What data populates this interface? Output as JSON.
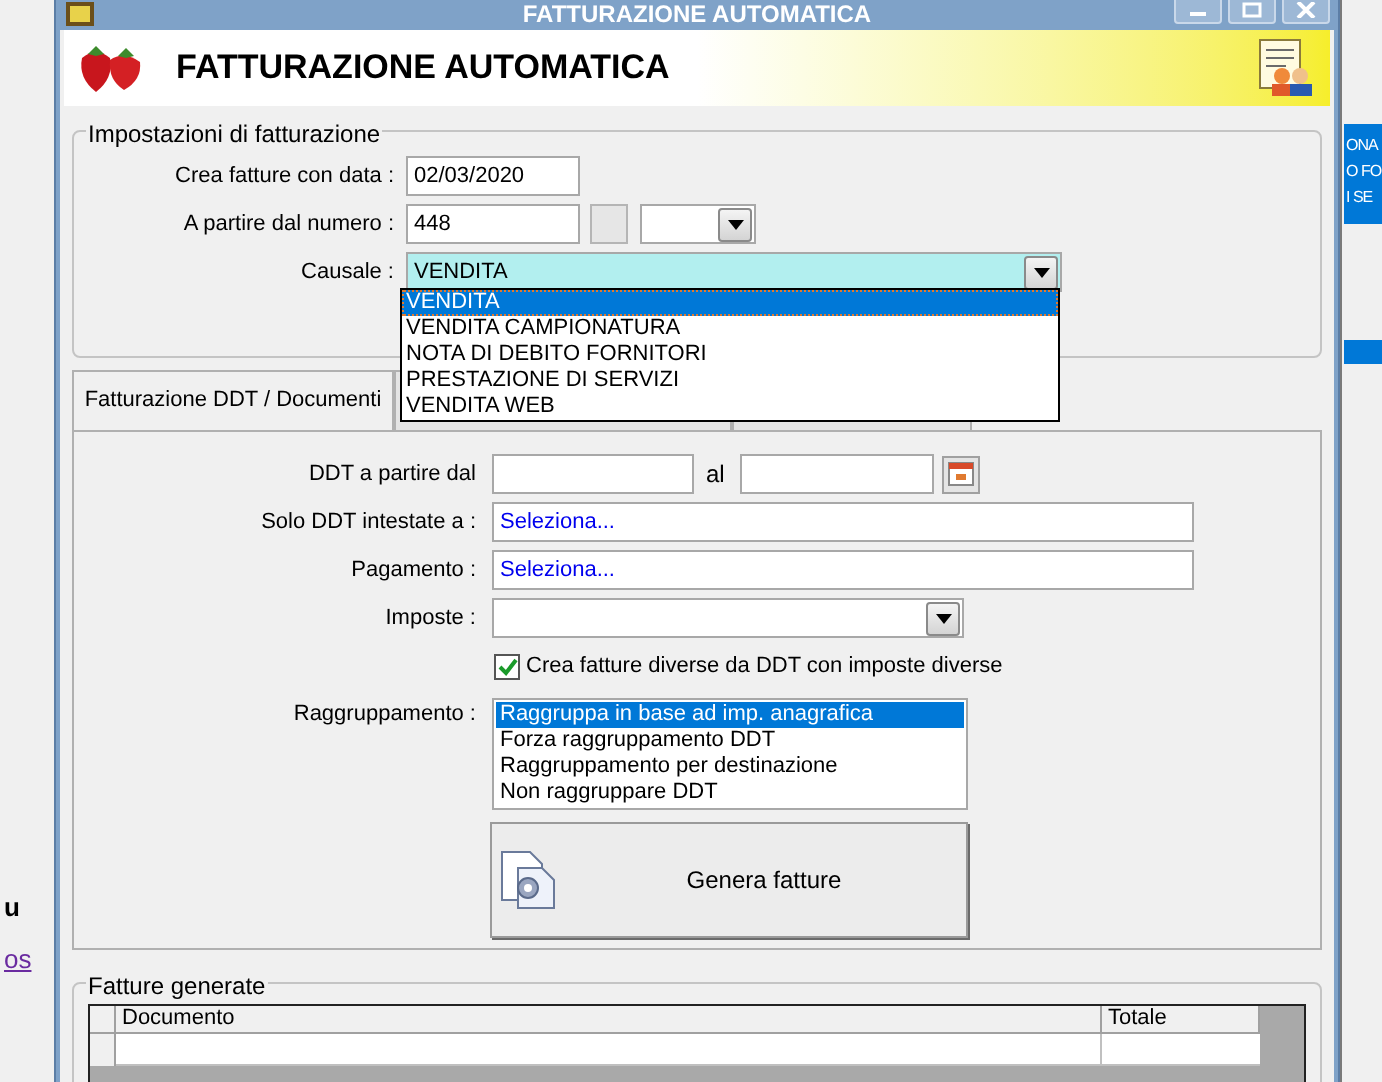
{
  "background": {
    "left_texts": [
      "u"
    ],
    "left_link": "os",
    "right_texts": [
      "ONA",
      "O FO",
      "I SE"
    ]
  },
  "window": {
    "title": "FATTURAZIONE AUTOMATICA"
  },
  "header": {
    "title": "FATTURAZIONE AUTOMATICA"
  },
  "settings": {
    "title": "Impostazioni di fatturazione",
    "date_label": "Crea fatture con data :",
    "date_value": "02/03/2020",
    "number_label": "A partire dal numero :",
    "number_value": "448",
    "causale_label": "Causale :",
    "causale_value": "VENDITA",
    "causale_options": [
      {
        "label": "VENDITA",
        "selected": true
      },
      {
        "label": "VENDITA CAMPIONATURA",
        "selected": false
      },
      {
        "label": "NOTA DI DEBITO FORNITORI",
        "selected": false
      },
      {
        "label": "PRESTAZIONE DI SERVIZI",
        "selected": false
      },
      {
        "label": "VENDITA WEB",
        "selected": false
      }
    ]
  },
  "tabs": [
    {
      "label": "Fatturazione DDT / Documenti",
      "selected": true
    },
    {
      "selected": false
    },
    {
      "selected": false
    }
  ],
  "ddt": {
    "from_label": "DDT a partire dal",
    "to_label": "al",
    "client_label": "Solo DDT intestate a :",
    "client_value": "Seleziona...",
    "payment_label": "Pagamento :",
    "payment_value": "Seleziona...",
    "tax_label": "Imposte :",
    "split_checkbox": {
      "label": "Crea fatture diverse da DDT con imposte diverse",
      "checked": true
    },
    "grouping_label": "Raggruppamento :",
    "grouping_options": [
      {
        "label": "Raggruppa in base ad imp. anagrafica",
        "selected": true
      },
      {
        "label": "Forza raggruppamento DDT",
        "selected": false
      },
      {
        "label": "Raggruppamento per destinazione",
        "selected": false
      },
      {
        "label": "Non raggruppare DDT",
        "selected": false
      }
    ],
    "generate_button": "Genera fatture"
  },
  "generated": {
    "title": "Fatture generate",
    "columns": [
      "Documento",
      "Totale"
    ]
  }
}
